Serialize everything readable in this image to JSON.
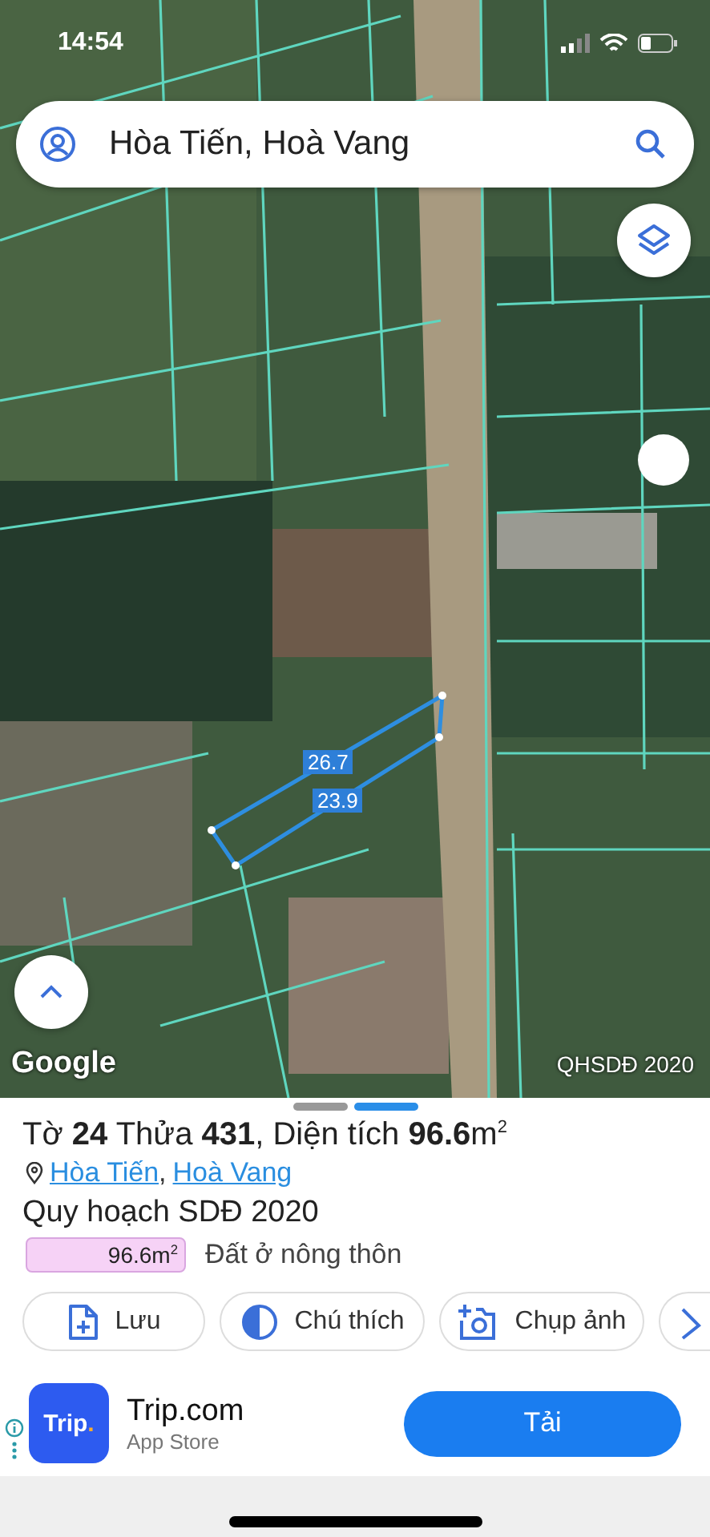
{
  "status_bar": {
    "time": "14:54"
  },
  "search": {
    "value": "Hòa Tiến, Hoà Vang"
  },
  "map": {
    "edge_labels": [
      "26.7",
      "23.9"
    ],
    "attribution": "Google",
    "layer_label": "QHSDĐ 2020"
  },
  "sheet": {
    "pages": [
      {
        "selected": false
      },
      {
        "selected": true
      }
    ],
    "title": "Tờ **24** Thửa **431**, Diện tích **96.6**m$^{2}$",
    "locations": [
      "Hòa Tiến",
      "Hoà Vang"
    ],
    "location_separator": ",",
    "plan": "Quy hoạch SDĐ 2020",
    "land_uses": [
      {
        "area": "96.6m$^{2}$",
        "label": "Đất ở nông thôn",
        "color": "#f6d2f6"
      }
    ],
    "actions": [
      {
        "kind": "save",
        "label": "Lưu"
      },
      {
        "kind": "legend",
        "label": "Chú thích"
      },
      {
        "kind": "camera",
        "label": "Chụp ảnh"
      },
      {
        "kind": "ruler"
      }
    ]
  },
  "ad": {
    "logo": "Trip",
    "logo_dot": ".",
    "name": "Trip.com",
    "store": "App Store",
    "button": "Tải"
  }
}
